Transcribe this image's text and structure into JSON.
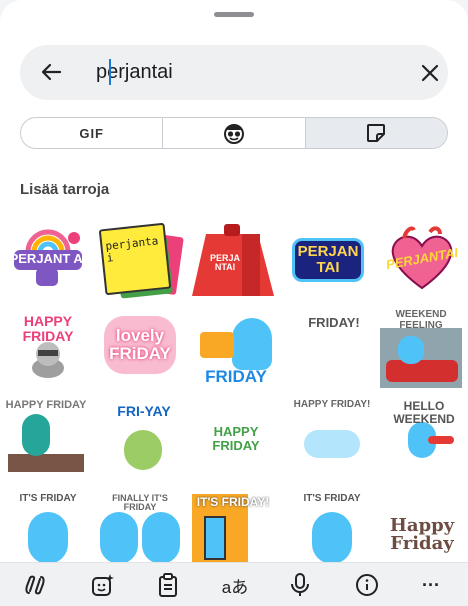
{
  "search": {
    "query": "perjantai",
    "back_icon": "arrow-left-icon",
    "clear_icon": "close-icon"
  },
  "tabs": [
    {
      "label": "GIF",
      "icon": null
    },
    {
      "label": "",
      "icon": "emoji-face-icon"
    },
    {
      "label": "",
      "icon": "sticker-icon"
    }
  ],
  "section_title": "Lisää tarroja",
  "stickers": [
    "PERJANT AI",
    "perjanta i",
    "PERJA NTAI",
    "PERJAN TAI",
    "PERJANTAI",
    "HAPPY FRIDAY",
    "lovely FRiDAY",
    "FRIDAY",
    "FRIDAY!",
    "WEEKEND FEELING",
    "HAPPY FRIDAY",
    "FRI-YAY",
    "HAPPY FRIDAY",
    "HAPPY FRIDAY!",
    "HELLO WEEKEND",
    "IT'S FRIDAY",
    "FINALLY IT'S FRIDAY",
    "IT'S FRIDAY!",
    "IT'S FRIDAY",
    "Happy Friday"
  ],
  "bottom_bar": [
    "copilot-icon",
    "sticker-sparkle-icon",
    "clipboard-icon",
    "translate-icon",
    "microphone-icon",
    "info-icon",
    "more-icon"
  ],
  "translate_glyph": "aあ",
  "more_glyph": "···"
}
